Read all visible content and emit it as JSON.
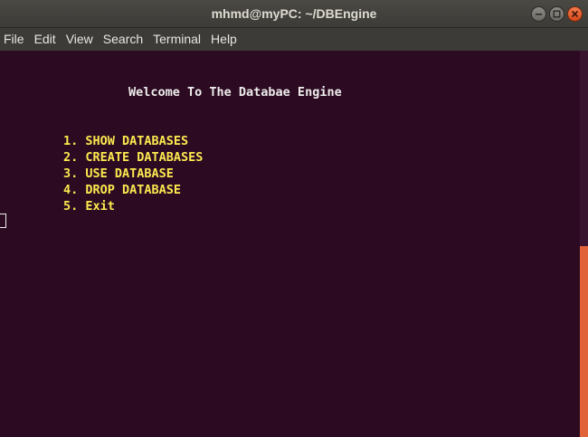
{
  "window": {
    "title": "mhmd@myPC: ~/DBEngine"
  },
  "menubar": {
    "items": [
      "File",
      "Edit",
      "View",
      "Search",
      "Terminal",
      "Help"
    ]
  },
  "terminal": {
    "welcome": "Welcome To The Databae Engine",
    "options": [
      "1. SHOW DATABASES",
      "2. CREATE DATABASES",
      "3. USE DATABASE",
      "4. DROP DATABASE",
      "5. Exit"
    ]
  },
  "colors": {
    "terminal_background": "#2c0a22",
    "welcome_text": "#eeeeec",
    "option_text": "#fce94f",
    "titlebar": "#3c3b37",
    "scrollbar_thumb": "#e0633a",
    "close_button": "#e05a2b"
  },
  "icons": [
    "minimize-icon",
    "maximize-icon",
    "close-icon"
  ]
}
